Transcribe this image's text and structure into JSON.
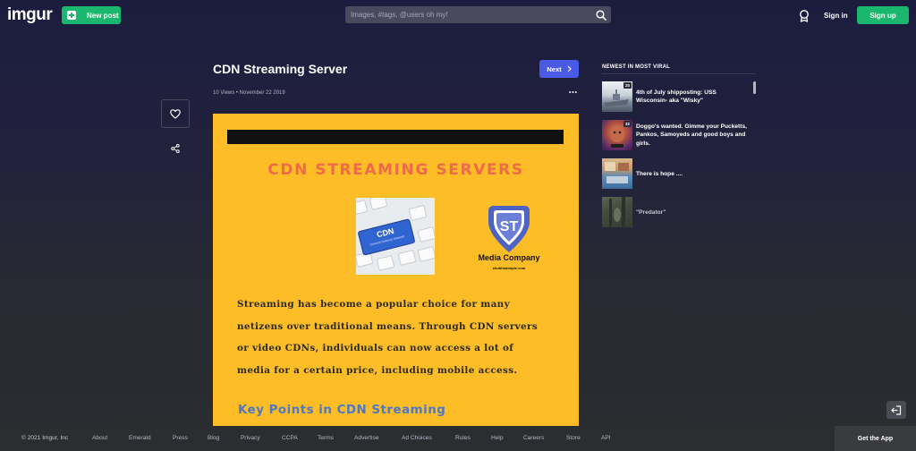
{
  "header": {
    "logo": "imgur",
    "new_post_label": "New post",
    "search_placeholder": "Images, #tags, @users oh my!",
    "sign_in_label": "Sign in",
    "sign_up_label": "Sign up"
  },
  "post": {
    "title": "CDN Streaming Server",
    "next_label": "Next",
    "meta": "10 Views • November 22 2019"
  },
  "post_image": {
    "heading": "CDN STREAMING SERVERS",
    "keyboard_key": "CDN",
    "keyboard_key_sub": "Content Delivery Network",
    "logo_letters": "ST",
    "logo_company": "Media Company",
    "logo_site": "shubhamtople.com",
    "paragraph_lines": [
      "Streaming has become a popular choice for many",
      "netizens over traditional means. Through CDN servers",
      "or video CDNs, individuals can now access a lot of",
      "media for a certain price, including mobile access."
    ],
    "subheading": "Key Points in CDN Streaming"
  },
  "sidebar": {
    "title": "NEWEST IN MOST VIRAL",
    "items": [
      {
        "title": "4th of July shipposting: USS Wisconsin- aka \"Wisky\"",
        "badge": "20",
        "thumb_colors": [
          "#dfe3e8",
          "#8a9aac",
          "#5b6675"
        ]
      },
      {
        "title": "Doggo's wanted. Gimme your Pucketts, Pankos, Samoyeds and good boys and girls.",
        "badge": "32",
        "thumb_colors": [
          "#6b3a8c",
          "#c4554a",
          "#3a2a4a"
        ]
      },
      {
        "title": "There is hope ....",
        "badge": "",
        "thumb_colors": [
          "#c2a27a",
          "#4a78a8",
          "#8a5a3a"
        ]
      },
      {
        "title": "\"Predator\"",
        "badge": "",
        "thumb_colors": [
          "#5a6a4a",
          "#7a8a6a",
          "#3a4a32"
        ]
      }
    ]
  },
  "footer": {
    "copyright": "© 2021 Imgur, Inc",
    "links": [
      "About",
      "Emerald",
      "Press",
      "Blog",
      "Privacy",
      "CCPA",
      "Terms",
      "Advertise",
      "Ad Choices",
      "Rules",
      "Help",
      "Careers",
      "Store",
      "API"
    ],
    "get_app_label": "Get the App"
  },
  "colors": {
    "accent_green": "#1bb76e",
    "next_blue": "#4b5ae4",
    "image_yellow": "#fcbd26",
    "heading_coral": "#f06a4a",
    "subheading_blue": "#4f78c4"
  }
}
